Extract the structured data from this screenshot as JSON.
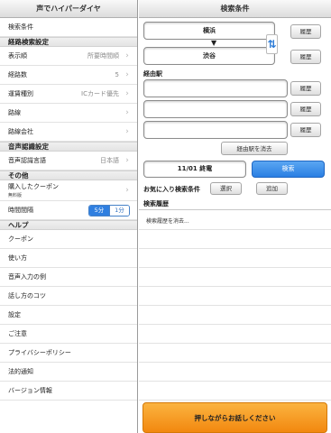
{
  "left": {
    "title": "声でハイパーダイヤ",
    "rows_top": [
      {
        "label": "検索条件",
        "value": "",
        "chevron": false
      }
    ],
    "section_route": "経路検索設定",
    "route_rows": [
      {
        "label": "表示順",
        "value": "所要時間順"
      },
      {
        "label": "経路数",
        "value": "5"
      },
      {
        "label": "運賃種別",
        "value": "ICカード優先"
      },
      {
        "label": "路線",
        "value": ""
      },
      {
        "label": "路線会社",
        "value": ""
      }
    ],
    "section_voice": "音声認識設定",
    "voice_row": {
      "label": "音声認識言語",
      "value": "日本語"
    },
    "section_other": "その他",
    "coupon": {
      "label": "購入したクーポン",
      "sub": "無料版"
    },
    "interval": {
      "label": "時間間隔",
      "opt1": "5分",
      "opt2": "1分"
    },
    "section_help": "ヘルプ",
    "help_rows": [
      "クーポン",
      "使い方",
      "音声入力の例",
      "話し方のコツ",
      "設定",
      "ご注意",
      "プライバシーポリシー",
      "法的通知",
      "バージョン情報"
    ]
  },
  "right": {
    "title": "検索条件",
    "from": "横浜",
    "to": "渋谷",
    "history_btn": "履歴",
    "via_label": "経由駅",
    "clear_via": "経由駅を消去",
    "datetime": "11/01 終電",
    "search": "検索",
    "favorites_label": "お気に入り検索条件",
    "select": "選択",
    "add": "追加",
    "history_head": "検索履歴",
    "history_clear": "検索履歴を消去...",
    "talk": "押しながらお話しください",
    "accent_color": "#2a7fe3",
    "talk_color": "#f2880f"
  }
}
